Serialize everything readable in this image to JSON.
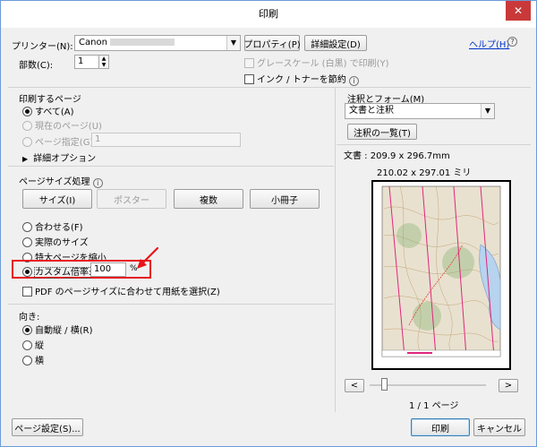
{
  "window": {
    "title": "印刷",
    "close_glyph": "✕"
  },
  "printer": {
    "label": "プリンター(N):",
    "name_prefix": "Canon",
    "properties_button": "プロパティ(P)",
    "advanced_button": "詳細設定(D)",
    "help_link": "ヘルプ(H)",
    "help_icon_glyph": "?",
    "copies_label": "部数(C):",
    "copies_value": "1",
    "grayscale_label": "グレースケール (白黒) で印刷(Y)",
    "save_ink_label": "インク / トナーを節約",
    "save_ink_info": "i"
  },
  "pages": {
    "heading": "印刷するページ",
    "all_label": "すべて(A)",
    "current_label": "現在のページ(U)",
    "range_label": "ページ指定(G)",
    "range_value": "1",
    "more_options_label": "詳細オプション",
    "more_options_glyph": "▶"
  },
  "sizing": {
    "heading": "ページサイズ処理",
    "info": "i",
    "tabs": [
      "サイズ(I)",
      "ポスター",
      "複数",
      "小冊子"
    ],
    "fit_label": "合わせる(F)",
    "actual_label": "実際のサイズ",
    "shrink_label": "特大ページを縮小",
    "custom_label": "カスタム倍率:",
    "custom_value": "100",
    "custom_unit": "%",
    "pdf_paper_label": "PDF のページサイズに合わせて用紙を選択(Z)"
  },
  "orientation": {
    "heading": "向き:",
    "auto_label": "自動縦 / 横(R)",
    "portrait_label": "縦",
    "landscape_label": "横"
  },
  "comments": {
    "heading": "注釈とフォーム(M)",
    "selected": "文書と注釈",
    "summary_button": "注釈の一覧(T)"
  },
  "preview": {
    "doc_size": "文書 : 209.9 x 296.7mm",
    "paper_size": "210.02 x 297.01 ミリ",
    "prev_glyph": "<",
    "next_glyph": ">",
    "page_indicator": "1 / 1 ページ"
  },
  "footer": {
    "page_setup_button": "ページ設定(S)...",
    "print_button": "印刷",
    "cancel_button": "キャンセル"
  },
  "colors": {
    "highlight": "#e8141b",
    "map_line": "#e0267e",
    "map_water": "#b7d3ee"
  }
}
